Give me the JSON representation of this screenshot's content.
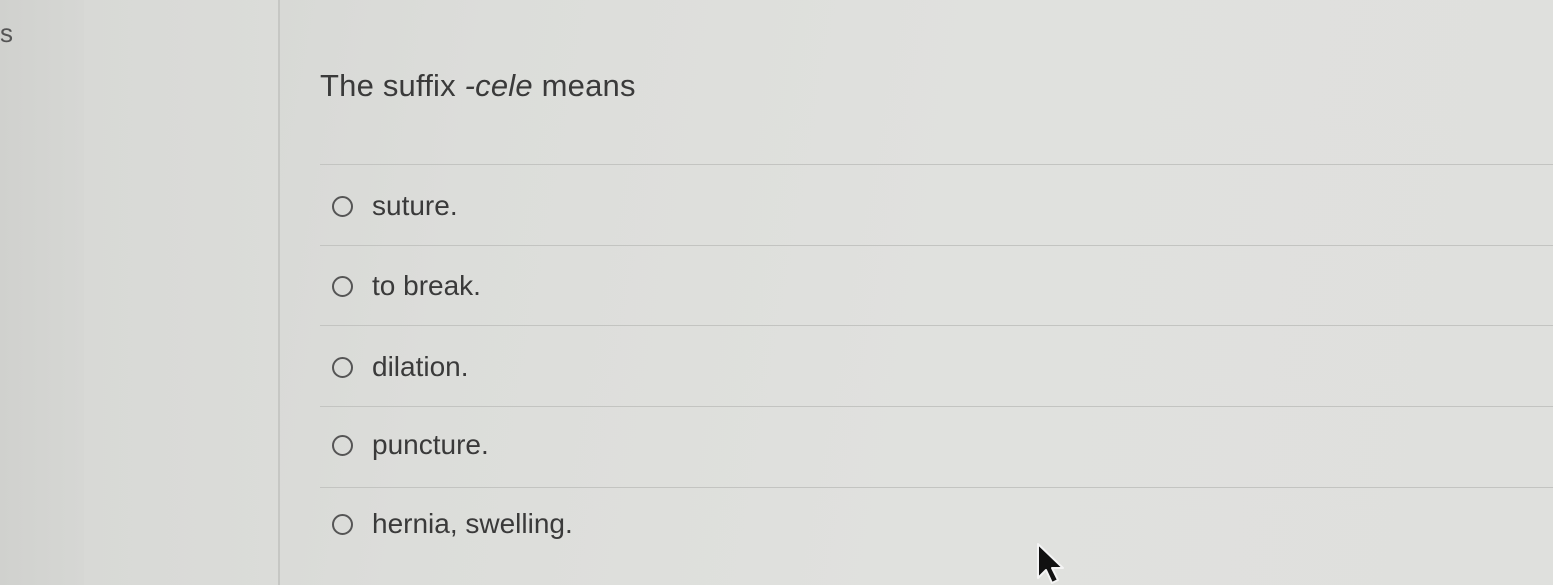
{
  "corner": {
    "letter": "s"
  },
  "question": {
    "prefix": "The suffix ",
    "term": "-cele",
    "suffix": " means"
  },
  "options": [
    {
      "label": "suture."
    },
    {
      "label": "to break."
    },
    {
      "label": "dilation."
    },
    {
      "label": "puncture."
    },
    {
      "label": "hernia, swelling."
    }
  ],
  "icons": {
    "radio": "radio-button-unselected-icon",
    "cursor": "mouse-pointer-icon"
  }
}
